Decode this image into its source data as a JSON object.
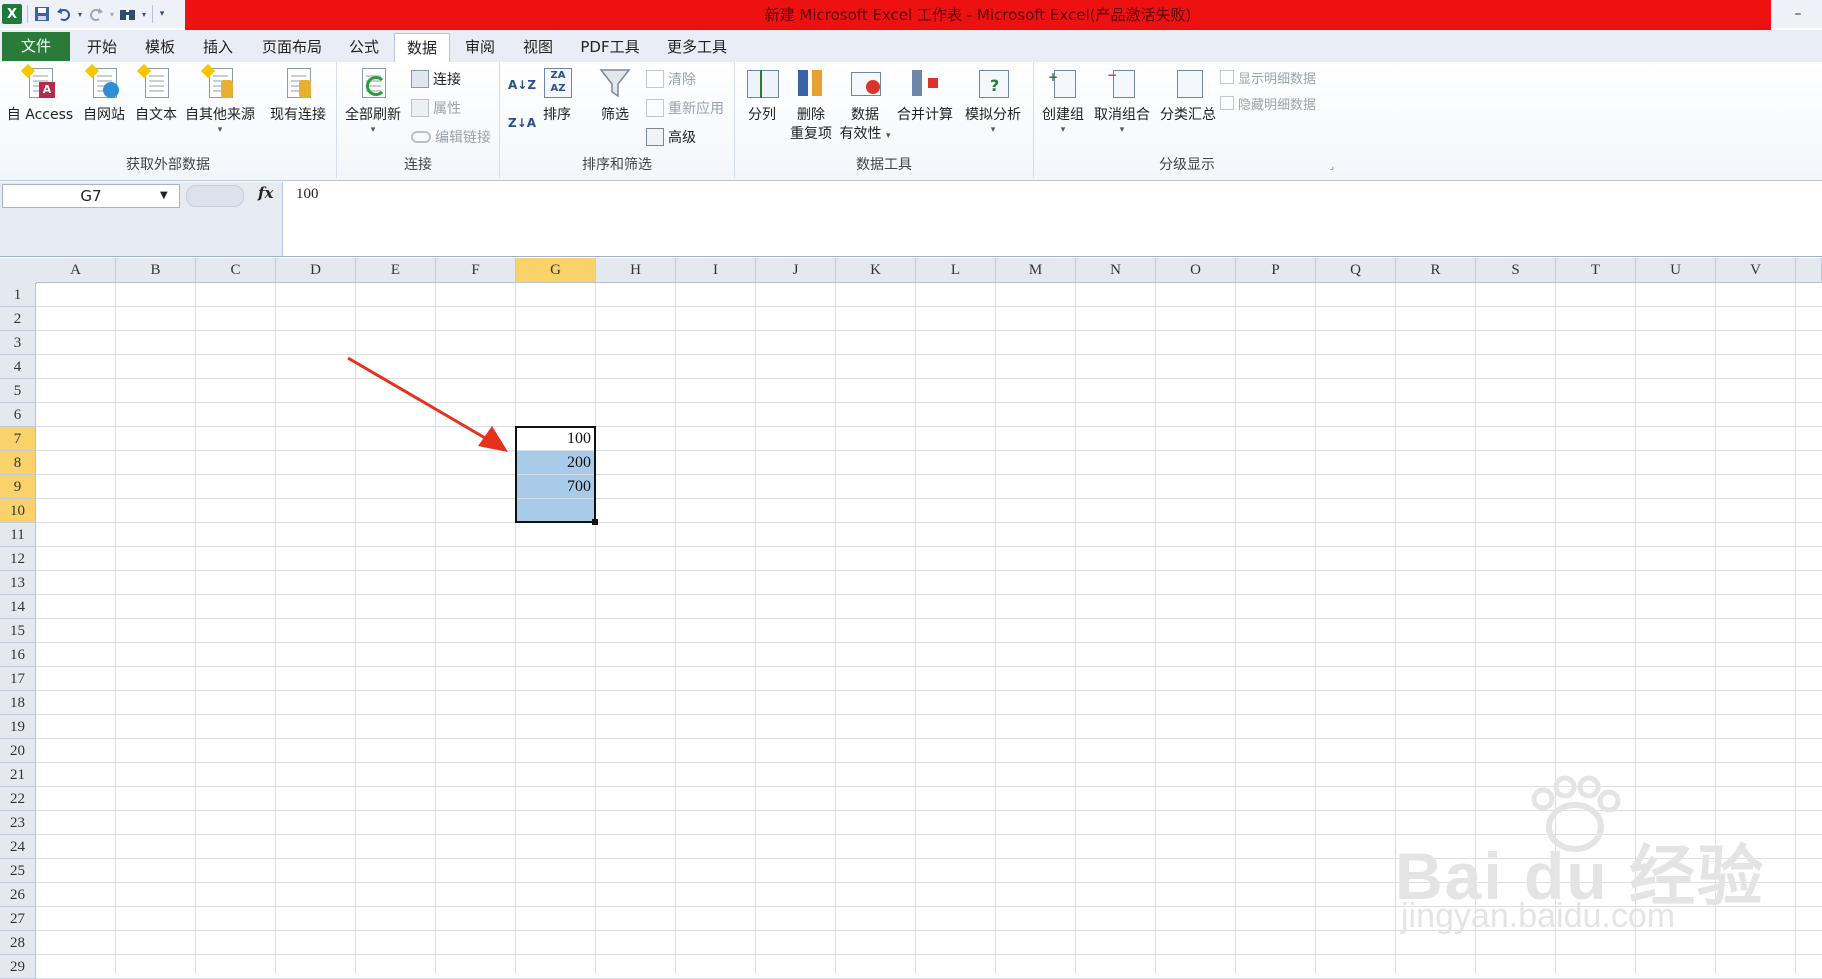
{
  "window": {
    "title": "新建 Microsoft Excel 工作表 - Microsoft Excel(产品激活失败)",
    "title_bg_color": "#ee1111",
    "quick_access": [
      "excel-logo",
      "save-icon",
      "undo-icon",
      "redo-icon",
      "find-icon",
      "customize-icon"
    ]
  },
  "tabs": [
    {
      "label": "文件"
    },
    {
      "label": "开始"
    },
    {
      "label": "模板"
    },
    {
      "label": "插入"
    },
    {
      "label": "页面布局"
    },
    {
      "label": "公式"
    },
    {
      "label": "数据"
    },
    {
      "label": "审阅"
    },
    {
      "label": "视图"
    },
    {
      "label": "PDF工具"
    },
    {
      "label": "更多工具"
    }
  ],
  "active_tab": "数据",
  "ribbon": {
    "external": {
      "label": "获取外部数据",
      "access": "自 Access",
      "web": "自网站",
      "text": "自文本",
      "other": "自其他来源",
      "existing": "现有连接"
    },
    "connections": {
      "label": "连接",
      "refresh_all": "全部刷新",
      "connections": "连接",
      "properties": "属性",
      "edit_links": "编辑链接"
    },
    "sort_filter": {
      "label": "排序和筛选",
      "sort": "排序",
      "filter": "筛选",
      "clear": "清除",
      "reapply": "重新应用",
      "advanced": "高级"
    },
    "data_tools": {
      "label": "数据工具",
      "text_to_columns": "分列",
      "remove_dup_1": "删除",
      "remove_dup_2": "重复项",
      "validation_1": "数据",
      "validation_2": "有效性",
      "consolidate": "合并计算",
      "what_if": "模拟分析"
    },
    "outline": {
      "label": "分级显示",
      "group": "创建组",
      "ungroup": "取消组合",
      "subtotal": "分类汇总",
      "show_detail": "显示明细数据",
      "hide_detail": "隐藏明细数据"
    }
  },
  "formula_bar": {
    "name_box": "G7",
    "fx": "fx",
    "value": "100"
  },
  "columns": [
    "A",
    "B",
    "C",
    "D",
    "E",
    "F",
    "G",
    "H",
    "I",
    "J",
    "K",
    "L",
    "M",
    "N",
    "O",
    "P",
    "Q",
    "R",
    "S",
    "T",
    "U",
    "V"
  ],
  "rows": [
    "1",
    "2",
    "3",
    "4",
    "5",
    "6",
    "7",
    "8",
    "9",
    "10",
    "11",
    "12",
    "13",
    "14",
    "15",
    "16",
    "17",
    "18",
    "19",
    "20",
    "21",
    "22",
    "23",
    "24",
    "25",
    "26",
    "27",
    "28",
    "29"
  ],
  "selected_column": "G",
  "selected_rows": [
    "7",
    "8",
    "9",
    "10"
  ],
  "cells": {
    "G7": "100",
    "G8": "200",
    "G9": "700"
  },
  "selection_color": "#a9cbea",
  "header_highlight_color": "#f9d36a",
  "annotation_arrow_color": "#e8301e",
  "watermark": {
    "line1": "Bai du 经验",
    "line2": "jingyan.baidu.com"
  }
}
